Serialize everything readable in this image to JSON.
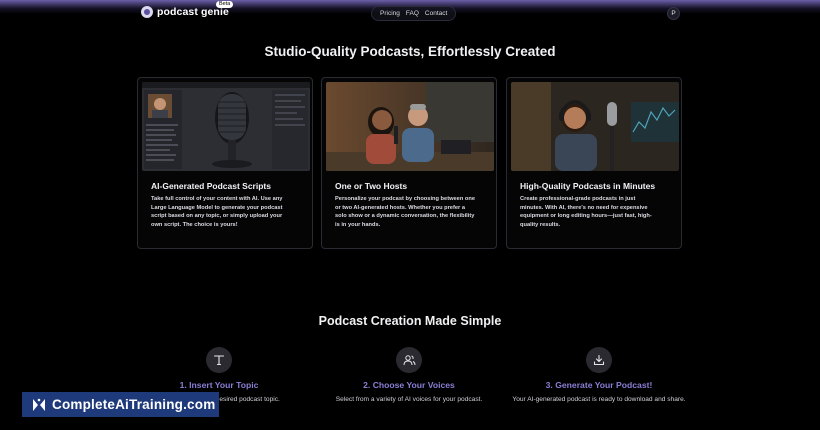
{
  "nav": {
    "logo_text": "podcast genie",
    "beta_label": "Beta",
    "links": [
      "Pricing",
      "FAQ",
      "Contact"
    ],
    "avatar_initial": "P"
  },
  "hero": {
    "title": "Studio-Quality Podcasts, Effortlessly Created"
  },
  "features": [
    {
      "title": "AI-Generated Podcast Scripts",
      "description": "Take full control of your content with AI. Use any Large Language Model to generate your podcast script based on any topic, or simply upload your own script. The choice is yours!"
    },
    {
      "title": "One or Two Hosts",
      "description": "Personalize your podcast by choosing between one or two AI-generated hosts. Whether you prefer a solo show or a dynamic conversation, the flexibility is in your hands."
    },
    {
      "title": "High-Quality Podcasts in Minutes",
      "description": "Create professional-grade podcasts in just minutes. With AI, there's no need for expensive equipment or long editing hours—just fast, high-quality results."
    }
  ],
  "steps_section": {
    "title": "Podcast Creation Made Simple",
    "steps": [
      {
        "icon": "text-icon",
        "title": "1. Insert Your Topic",
        "description": "Simply type in your desired podcast topic."
      },
      {
        "icon": "users-icon",
        "title": "2. Choose Your Voices",
        "description": "Select from a variety of AI voices for your podcast."
      },
      {
        "icon": "download-icon",
        "title": "3. Generate Your Podcast!",
        "description": "Your AI-generated podcast is ready to download and share."
      }
    ]
  },
  "watermark": {
    "text": "CompleteAiTraining.com"
  },
  "colors": {
    "background": "#000000",
    "accent": "#8a7fd6",
    "card_border": "#2a2a33"
  }
}
